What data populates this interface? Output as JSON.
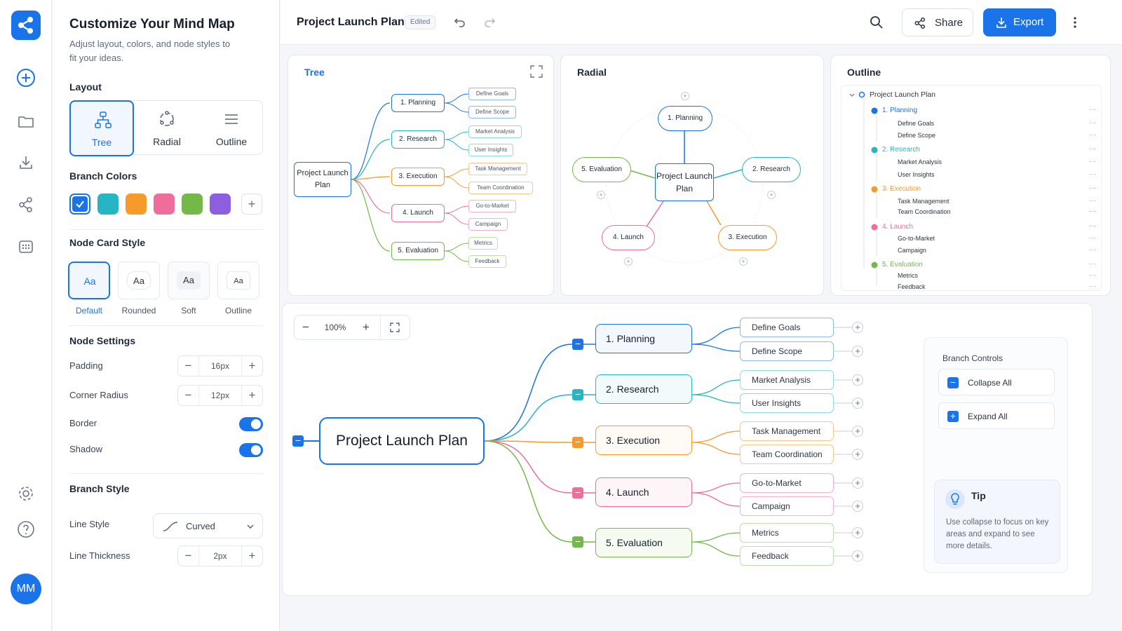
{
  "sidebar": {
    "avatar_initials": "MM"
  },
  "panel": {
    "title": "Customize Your Mind Map",
    "subtitle": "Adjust layout, colors, and node styles to fit your ideas.",
    "layout": {
      "label": "Layout",
      "options": [
        "Tree",
        "Radial",
        "Outline"
      ],
      "selected": "Tree"
    },
    "branch_colors": {
      "label": "Branch Colors",
      "swatches": [
        "#1a73e8",
        "#26b5c2",
        "#f79a2c",
        "#ee6d9a",
        "#74b84a",
        "#8d5ee0"
      ],
      "add_label": "+"
    },
    "node_card_style": {
      "label": "Node Card Style",
      "preview": "Aa",
      "options": [
        "Default",
        "Rounded",
        "Soft",
        "Outline"
      ],
      "selected": "Default"
    },
    "node_settings": {
      "label": "Node Settings",
      "padding_label": "Padding",
      "padding_value": "16px",
      "radius_label": "Corner Radius",
      "radius_value": "12px",
      "border_label": "Border",
      "shadow_label": "Shadow"
    },
    "branch_style": {
      "label": "Branch Style",
      "line_style_label": "Line Style",
      "line_style_value": "Curved",
      "thickness_label": "Line Thickness",
      "thickness_value": "2px"
    }
  },
  "topbar": {
    "title": "Project Launch Plan",
    "badge": "Edited",
    "share_label": "Share",
    "export_label": "Export"
  },
  "previews": {
    "tree_title": "Tree",
    "radial_title": "Radial",
    "outline_title": "Outline",
    "root_label": "Project Launch Plan",
    "branches": [
      {
        "label": "1. Planning",
        "color": "#1a73e8",
        "children": [
          "Define Goals",
          "Define Scope"
        ]
      },
      {
        "label": "2. Research",
        "color": "#26b5c2",
        "children": [
          "Market Analysis",
          "User Insights"
        ]
      },
      {
        "label": "3. Execution",
        "color": "#f79a2c",
        "children": [
          "Task Management",
          "Team Coordination"
        ]
      },
      {
        "label": "4. Launch",
        "color": "#ee6d9a",
        "children": [
          "Go-to-Market",
          "Campaign"
        ]
      },
      {
        "label": "5. Evaluation",
        "color": "#74b84a",
        "children": [
          "Metrics",
          "Feedback"
        ]
      }
    ],
    "outline_dots": "···"
  },
  "canvas": {
    "zoom_value": "100%",
    "root_label": "Project Launch Plan",
    "branch_controls": {
      "title": "Branch Controls",
      "collapse_label": "Collapse All",
      "expand_label": "Expand All"
    },
    "tip": {
      "title": "Tip",
      "text": "Use collapse to focus on key areas and expand to see more details."
    }
  }
}
